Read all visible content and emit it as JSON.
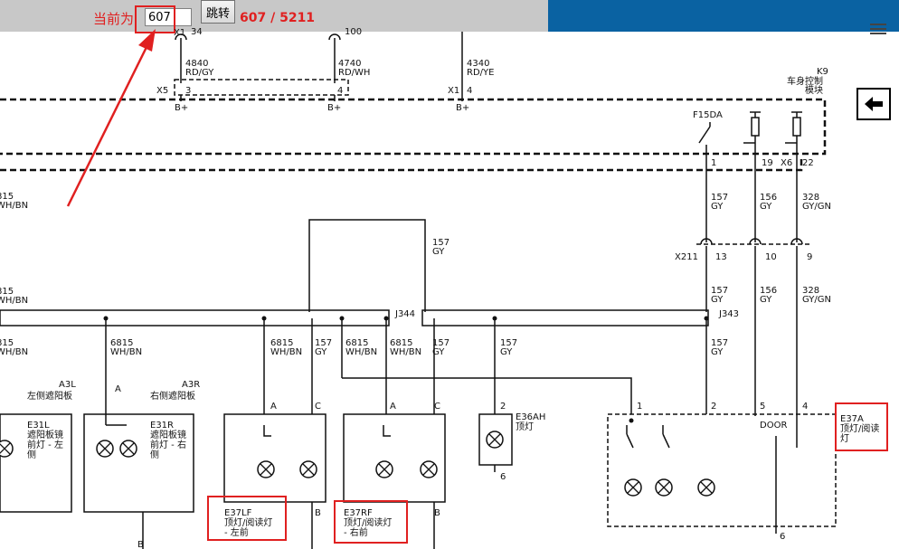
{
  "toolbar": {
    "current_label": "当前为",
    "page_input_value": "607",
    "goto_label": "跳转",
    "page_count": "607 / 5211"
  },
  "top_connector": {
    "x1_pin": "X1",
    "pin_34": "34",
    "pin_100": "100",
    "x5_label": "X5",
    "x5_pin3": "3",
    "x5_pin4": "4",
    "x1_label": "X1",
    "x1_pin4": "4",
    "b_plus": "B+"
  },
  "wires_top": [
    {
      "num": "4840",
      "color": "RD/GY"
    },
    {
      "num": "4740",
      "color": "RD/WH"
    },
    {
      "num": "4340",
      "color": "RD/YE"
    }
  ],
  "bcm": {
    "id": "K9",
    "name_line1": "车身控制",
    "name_line2": "模块",
    "fuse": "F15DA",
    "pin1": "1",
    "pin19": "19",
    "x6": "X6",
    "pin22": "22"
  },
  "wires_mid": [
    {
      "num": "157",
      "color": "GY"
    },
    {
      "num": "156",
      "color": "GY"
    },
    {
      "num": "328",
      "color": "GY/GN"
    }
  ],
  "x211": {
    "label": "X211",
    "pin13": "13",
    "pin10": "10",
    "pin9": "9"
  },
  "left_edge": {
    "w1_num": "815",
    "w1_color": "WH/BN",
    "w2_num": "815",
    "w2_color": "WH/BN",
    "w3_num": "815",
    "w3_color": "WH/BN"
  },
  "center_wire": {
    "num": "157",
    "color": "GY"
  },
  "splices": {
    "j344": "J344",
    "j343": "J343"
  },
  "lower_wires": [
    {
      "num": "6815",
      "color": "WH/BN"
    },
    {
      "num": "6815",
      "color": "WH/BN"
    },
    {
      "num": "157",
      "color": "GY"
    },
    {
      "num": "6815",
      "color": "WH/BN"
    },
    {
      "num": "6815",
      "color": "WH/BN"
    },
    {
      "num": "157",
      "color": "GY"
    },
    {
      "num": "157",
      "color": "GY"
    },
    {
      "num": "157",
      "color": "GY"
    }
  ],
  "components": {
    "a3l": {
      "id": "A3L",
      "name": "左侧遮阳板"
    },
    "a3r": {
      "id": "A3R",
      "name": "右侧遮阳板"
    },
    "e31l": {
      "id": "E31L",
      "l1": "遮阳板镜",
      "l2": "前灯 - 左",
      "l3": "侧"
    },
    "e31r": {
      "id": "E31R",
      "l1": "遮阳板镜",
      "l2": "前灯 - 右",
      "l3": "侧"
    },
    "e37lf": {
      "id": "E37LF",
      "l1": "顶灯/阅读灯",
      "l2": "- 左前"
    },
    "e37rf": {
      "id": "E37RF",
      "l1": "顶灯/阅读灯",
      "l2": "- 右前"
    },
    "e36ah": {
      "id": "E36AH",
      "name": "顶灯"
    },
    "e37a": {
      "id": "E37A",
      "l1": "顶灯/阅读",
      "l2": "灯"
    }
  },
  "pins": {
    "a": "A",
    "b": "B",
    "c": "C",
    "p1": "1",
    "p2": "2",
    "p4": "4",
    "p5": "5",
    "p6": "6",
    "door": "DOOR"
  },
  "icons": [
    "menu-icon",
    "back-arrow-icon",
    "lamp-icon",
    "switch-icon"
  ]
}
